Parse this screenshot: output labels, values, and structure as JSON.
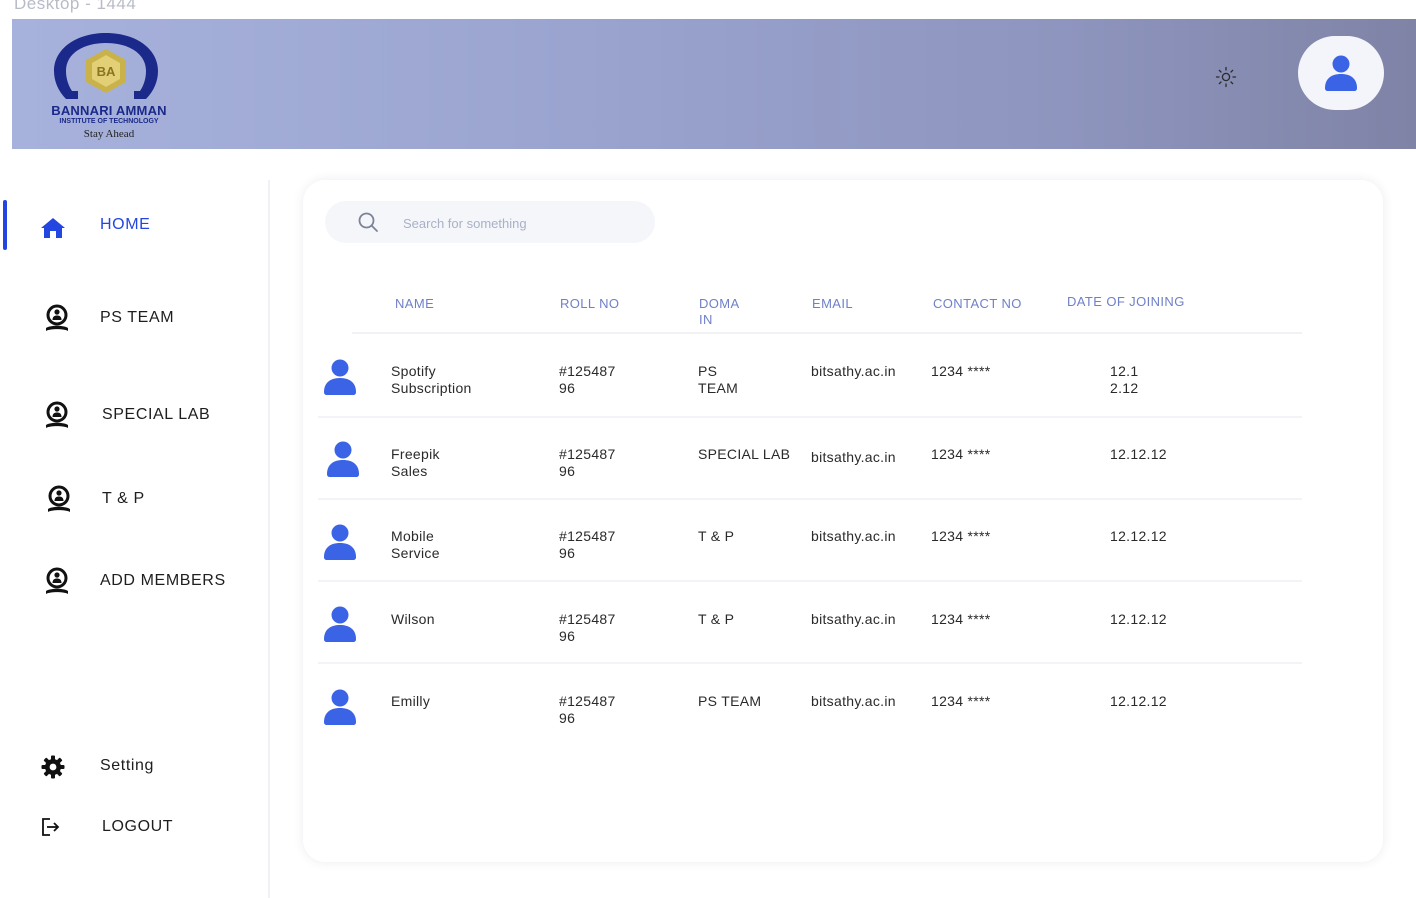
{
  "frame_label": "Desktop - 1444",
  "brand": {
    "name": "BANNARI AMMAN",
    "subtitle": "INSTITUTE OF TECHNOLOGY",
    "tagline": "Stay Ahead"
  },
  "colors": {
    "accent": "#2346e0",
    "avatar": "#3b63e6",
    "header_start": "#a7b2dc",
    "header_end": "#7f83a6"
  },
  "header": {
    "theme_icon": "sun-icon",
    "profile_icon": "user-icon"
  },
  "sidebar": {
    "items": [
      {
        "label": "HOME",
        "icon": "home-icon",
        "active": true
      },
      {
        "label": "PS TEAM",
        "icon": "team-icon"
      },
      {
        "label": "SPECIAL LAB",
        "icon": "team-icon"
      },
      {
        "label": "T & P",
        "icon": "team-icon"
      },
      {
        "label": "ADD MEMBERS",
        "icon": "team-icon"
      }
    ],
    "footer": [
      {
        "label": "Setting",
        "icon": "gear-icon"
      },
      {
        "label": "LOGOUT",
        "icon": "logout-icon"
      }
    ]
  },
  "search": {
    "placeholder": "Search for something",
    "value": ""
  },
  "table": {
    "headers": [
      "NAME",
      "ROLL NO",
      "DOMAIN",
      "EMAIL",
      "CONTACT NO",
      "DATE OF JOINING"
    ],
    "rows": [
      {
        "name": "Spotify Subscription",
        "roll": "#12548796",
        "domain": "PS TEAM",
        "email": "bitsathy.ac.in",
        "contact": "1234 ****",
        "date": "12.12.12"
      },
      {
        "name": "Freepik Sales",
        "roll": "#12548796",
        "domain": "SPECIAL LAB",
        "email": "bitsathy.ac.in",
        "contact": "1234 ****",
        "date": "12.12.12"
      },
      {
        "name": "Mobile Service",
        "roll": "#12548796",
        "domain": "T & P",
        "email": "bitsathy.ac.in",
        "contact": "1234 ****",
        "date": "12.12.12"
      },
      {
        "name": "Wilson",
        "roll": "#12548796",
        "domain": "T & P",
        "email": "bitsathy.ac.in",
        "contact": "1234 ****",
        "date": "12.12.12"
      },
      {
        "name": "Emilly",
        "roll": "#12548796",
        "domain": "PS TEAM",
        "email": "bitsathy.ac.in",
        "contact": "1234 ****",
        "date": "12.12.12"
      }
    ]
  }
}
